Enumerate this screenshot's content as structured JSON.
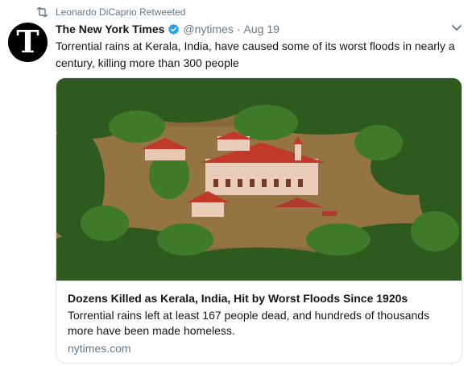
{
  "retweet": {
    "icon": "retweet-icon",
    "text": "Leonardo DiCaprio Retweeted"
  },
  "tweet": {
    "avatar_glyph": "T",
    "author_name": "The New York Times",
    "verified_icon": "verified-badge-icon",
    "handle": "@nytimes",
    "separator": "·",
    "date": "Aug 19",
    "menu_icon": "chevron-down-icon",
    "text": "Torrential rains at Kerala, India, have caused some of its worst floods in nearly a century, killing more than 300 people"
  },
  "card": {
    "image_alt": "Aerial view of flooded Kerala with palm trees and red-roofed buildings",
    "title": "Dozens Killed as Kerala, India, Hit by Worst Floods Since 1920s",
    "description": "Torrential rains left at least 167 people dead, and hundreds of thousands more have been made homeless.",
    "domain": "nytimes.com"
  },
  "colors": {
    "text_primary": "#14171a",
    "text_secondary": "#657786",
    "verified_blue": "#1da1f2",
    "border": "#e1e8ed",
    "flood_water": "#8a6a3a",
    "roof_red": "#c0392b",
    "palm_green": "#2e5a1f"
  }
}
